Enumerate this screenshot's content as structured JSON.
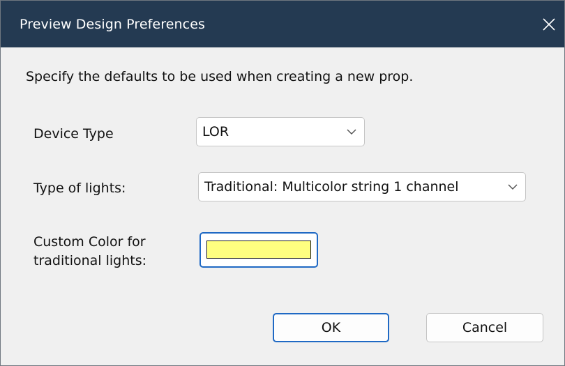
{
  "window": {
    "title": "Preview Design Preferences",
    "close_icon": "close-icon"
  },
  "instructions": "Specify the defaults to be used when creating a new prop.",
  "device_type": {
    "label": "Device Type",
    "value": "LOR"
  },
  "type_of_lights": {
    "label": "Type of lights:",
    "value": "Traditional: Multicolor string 1 channel"
  },
  "custom_color": {
    "label_line1": "Custom Color for",
    "label_line2": "traditional lights:",
    "swatch_color": "#ffff80"
  },
  "buttons": {
    "ok": "OK",
    "cancel": "Cancel"
  },
  "colors": {
    "titlebar": "#243a52",
    "background": "#f0f0f0",
    "focus_border": "#1f69c4"
  }
}
